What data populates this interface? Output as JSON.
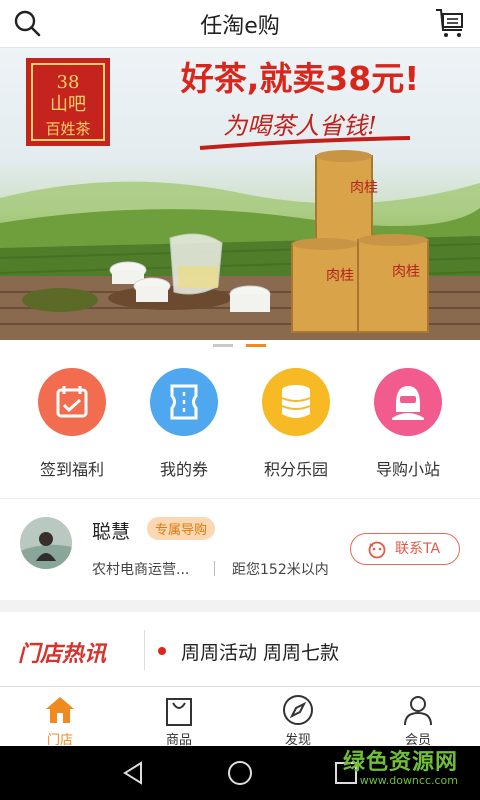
{
  "header": {
    "title": "任淘e购",
    "search_icon": "search-icon",
    "cart_icon": "cart-icon"
  },
  "banner": {
    "logo_number": "38",
    "logo_text": "山吧",
    "logo_subtitle": "百姓茶",
    "headline": "好茶,就卖38元!",
    "slogan": "为喝茶人省钱!",
    "can_label": "肉桂",
    "slides_total": 2,
    "active_slide": 2
  },
  "quick_links": [
    {
      "label": "签到福利",
      "icon": "calendar-icon",
      "color": "#f26c4f"
    },
    {
      "label": "我的券",
      "icon": "ticket-icon",
      "color": "#4fa8ef"
    },
    {
      "label": "积分乐园",
      "icon": "coins-icon",
      "color": "#f7b924"
    },
    {
      "label": "导购小站",
      "icon": "guide-avatar-icon",
      "color": "#f25b8e"
    }
  ],
  "guide": {
    "name": "聪慧",
    "badge": "专属导购",
    "description": "农村电商运营...",
    "distance": "距您152米以内",
    "contact_label": "联系TA"
  },
  "news": {
    "section_title": "门店热讯",
    "headline": "周周活动 周周七款"
  },
  "tabs": [
    {
      "label": "门店",
      "icon": "home-icon",
      "active": true
    },
    {
      "label": "商品",
      "icon": "shopping-bag-icon",
      "active": false
    },
    {
      "label": "发现",
      "icon": "compass-icon",
      "active": false
    },
    {
      "label": "会员",
      "icon": "user-icon",
      "active": false
    }
  ],
  "watermark": {
    "title": "绿色资源网",
    "url": "www.downcc.com"
  },
  "colors": {
    "accent": "#f08a1f",
    "contact_border": "#e86b5a",
    "news_title": "#d8322b"
  }
}
